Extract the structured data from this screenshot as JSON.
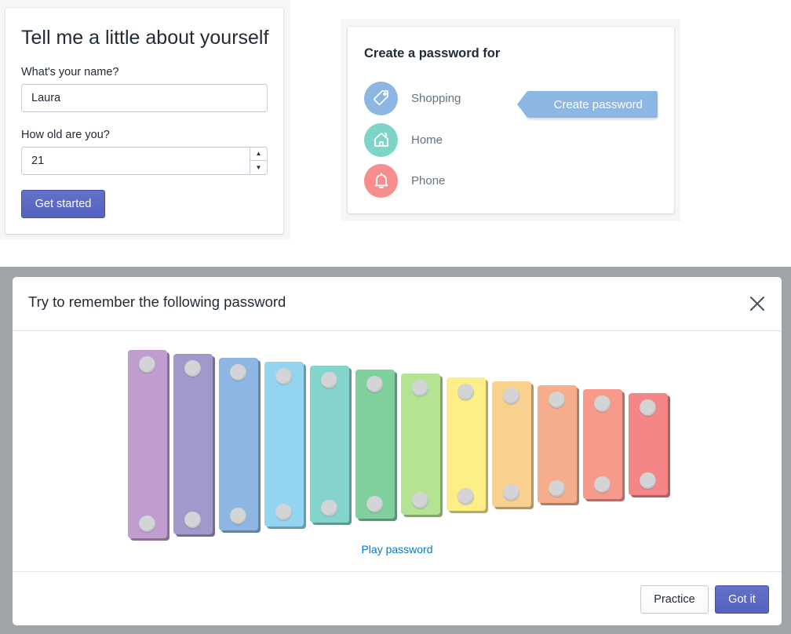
{
  "profile_form": {
    "title": "Tell me a little about yourself",
    "name_label": "What's your name?",
    "name_value": "Laura",
    "age_label": "How old are you?",
    "age_value": "21",
    "submit_label": "Get started",
    "colors": {
      "primary": "#5c6ac4",
      "border": "#c4cdd5"
    }
  },
  "password_create": {
    "title": "Create a password for",
    "accounts": [
      {
        "label": "Shopping",
        "icon": "tag-icon",
        "color": "#8db6e3"
      },
      {
        "label": "Home",
        "icon": "house-icon",
        "color": "#7fd4c8"
      },
      {
        "label": "Phone",
        "icon": "bell-icon",
        "color": "#f88d8d"
      }
    ],
    "tooltip_label": "Create password"
  },
  "modal": {
    "title": "Try to remember the following password",
    "play_label": "Play password",
    "practice_label": "Practice",
    "confirm_label": "Got it",
    "close_icon": "close-icon",
    "xylophone_colors": [
      "#c09ccf",
      "#a398cb",
      "#8db6e3",
      "#93d5f0",
      "#85d3cd",
      "#7fd09d",
      "#b4e393",
      "#fdee88",
      "#f9d18f",
      "#f6ad8c",
      "#f79a8c",
      "#f58687"
    ]
  }
}
